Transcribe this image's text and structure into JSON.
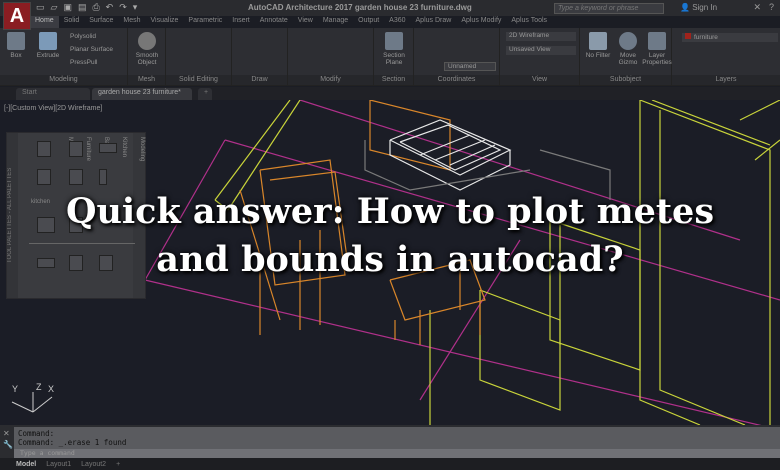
{
  "app": {
    "logo": "A",
    "title": "AutoCAD Architecture 2017   garden house 23 furniture.dwg",
    "search_placeholder": "Type a keyword or phrase",
    "sign_in": "Sign In"
  },
  "ribbon_tabs": [
    "Home",
    "Solid",
    "Surface",
    "Mesh",
    "Visualize",
    "Parametric",
    "Insert",
    "Annotate",
    "View",
    "Manage",
    "Output",
    "A360",
    "Aplus Draw",
    "Aplus Modify",
    "Aplus Tools"
  ],
  "ribbon": {
    "modeling": {
      "label": "Modeling",
      "box": "Box",
      "extrude": "Extrude",
      "polysolid": "Polysolid",
      "planar_surface": "Planar Surface",
      "presspull": "PressPull"
    },
    "mesh": {
      "label": "Mesh",
      "smooth_object": "Smooth Object"
    },
    "solid_editing": {
      "label": "Solid Editing"
    },
    "draw": {
      "label": "Draw"
    },
    "modify": {
      "label": "Modify"
    },
    "section": {
      "label": "Section",
      "section_plane": "Section Plane"
    },
    "coordinates": {
      "label": "Coordinates",
      "ucs_value": "Unnamed"
    },
    "view": {
      "label": "View",
      "visual_style": "2D Wireframe",
      "saved_view": "Unsaved View"
    },
    "subobject": {
      "label": "Subobject",
      "no_filter": "No Filter",
      "move_gizmo": "Move Gizmo"
    },
    "layers": {
      "label": "Layers",
      "layer_properties": "Layer Properties",
      "current_layer": "furniture"
    }
  },
  "doc_tabs": {
    "start": "Start",
    "active": "garden house 23 furniture*"
  },
  "viewport": {
    "label": "[-][Custom View][2D Wireframe]",
    "palette_section": "kitchen",
    "palette_title": "TOOL PALETTES - ALL PALETTES",
    "palette_tabs": [
      "Modeling",
      "Kitchen",
      "Bath",
      "Furniture",
      "Misc"
    ],
    "ucs": {
      "x": "X",
      "y": "Y",
      "z": "Z"
    }
  },
  "headline": {
    "line1": "Quick answer: How to plot metes",
    "line2": "and bounds in autocad?"
  },
  "command": {
    "lines": [
      "Command:",
      "Command:  _.erase 1 found"
    ],
    "placeholder": "Type a command"
  },
  "layout_tabs": [
    "Model",
    "Layout1",
    "Layout2"
  ],
  "colors": {
    "accent": "#8a1d22",
    "wire_yellow": "#c9d43a",
    "wire_orange": "#d9862a",
    "wire_magenta": "#b0308a"
  }
}
